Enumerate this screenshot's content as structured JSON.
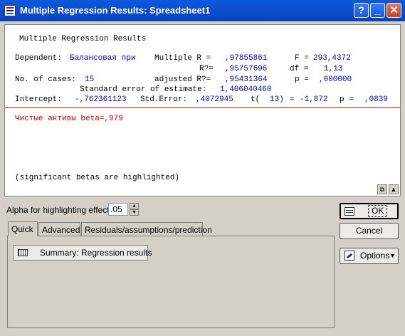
{
  "window": {
    "title": "Multiple Regression Results: Spreadsheet1",
    "help_glyph": "?",
    "minimize_glyph": "_",
    "close_glyph": "✕"
  },
  "report": {
    "heading": "Multiple Regression Results",
    "dependent_label": "Dependent:",
    "dependent_value": "Балансовая при",
    "multiple_r_label": "Multiple R =",
    "multiple_r_value": ",97855861",
    "f_label": "F =",
    "f_value": "293,4372",
    "r2_label": "R?=",
    "r2_value": ",95757696",
    "df_label": "df =",
    "df_value": "1,13",
    "cases_label": "No. of cases:",
    "cases_value": "15",
    "adj_r2_label": "adjusted R?=",
    "adj_r2_value": ",95431364",
    "p_label": "p =",
    "p_value": ",000000",
    "std_err_label": "Standard error of estimate:",
    "std_err_value": "1,406040460",
    "intercept_label": "Intercept:",
    "intercept_value": "-,762361123",
    "intercept_se_label": "Std.Error:",
    "intercept_se_value": ",4072945",
    "t_label": "t(",
    "t_df": "13)",
    "t_eq": "=",
    "t_value": "-1,872",
    "intercept_p_label": "p =",
    "intercept_p_value": ",0839",
    "beta_line": "Чистые активы beta=,979",
    "footnote": "(significant betas are highlighted)",
    "copy_icon_glyph": "⧉",
    "up_icon_glyph": "▲"
  },
  "alpha": {
    "label": "Alpha for highlighting effects:",
    "value": ".05"
  },
  "tabs": [
    {
      "label": "Quick"
    },
    {
      "label": "Advanced"
    },
    {
      "label": "Residuals/assumptions/prediction"
    }
  ],
  "quick": {
    "summary_label": "Summary:  Regression results"
  },
  "buttons": {
    "ok": "OK",
    "cancel": "Cancel",
    "options": "Options",
    "options_caret": "▼",
    "spin_up": "▲",
    "spin_down": "▼"
  },
  "colors": {
    "title_bar": "#0843bf",
    "value_text": "#0000c0",
    "highlight": "#c00000"
  }
}
